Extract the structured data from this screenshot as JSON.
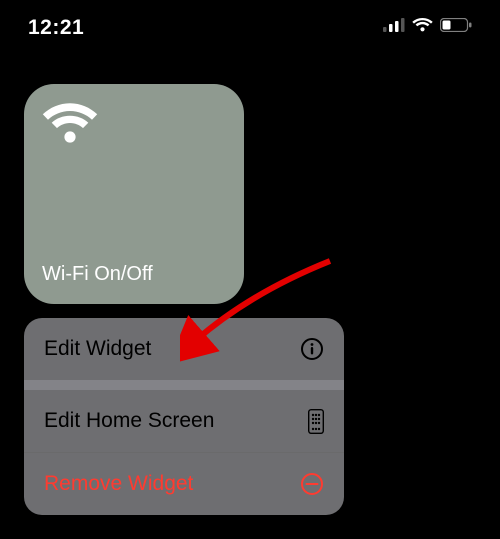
{
  "status": {
    "time": "12:21"
  },
  "widget": {
    "label": "Wi-Fi On/Off"
  },
  "menu": {
    "edit_widget": "Edit Widget",
    "edit_home_screen": "Edit Home Screen",
    "remove_widget": "Remove Widget"
  },
  "colors": {
    "danger": "#ff3b30",
    "widget_bg": "#8f9a90"
  }
}
